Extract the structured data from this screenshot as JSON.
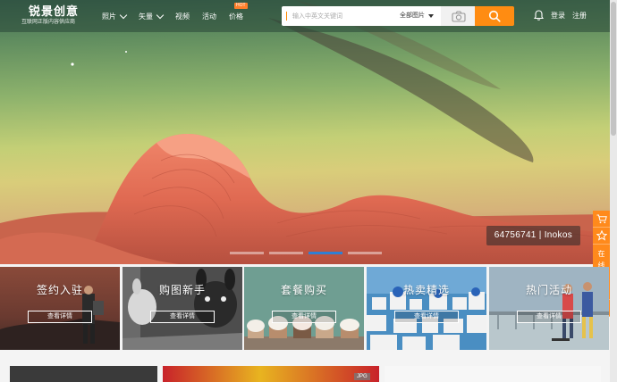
{
  "header": {
    "logo_title": "锐景创意",
    "logo_subtitle": "互联网正版内容供应商",
    "nav": [
      {
        "label": "照片",
        "dropdown": true
      },
      {
        "label": "矢量",
        "dropdown": true
      },
      {
        "label": "视频",
        "dropdown": false
      },
      {
        "label": "活动",
        "dropdown": false
      },
      {
        "label": "价格",
        "dropdown": false,
        "badge": "HOT"
      }
    ],
    "search": {
      "placeholder": "输入中英文关键词",
      "value": "",
      "scope": "全部图片",
      "camera_icon": "camera-icon",
      "search_icon": "search-icon"
    },
    "user": {
      "bell_icon": "bell-icon",
      "login": "登录",
      "register": "注册"
    }
  },
  "hero": {
    "photo_id": "64756741 | Inokos",
    "carousel_total": 4,
    "carousel_active": 2
  },
  "side_toolbar": {
    "cart_icon": "cart-icon",
    "star_icon": "star-icon",
    "customer_service": [
      "在",
      "线",
      "客",
      "服"
    ],
    "edit_icon": "edit-icon"
  },
  "cards": [
    {
      "title": "签约入驻",
      "button": "查看详情"
    },
    {
      "title": "购图新手",
      "button": "查看详情"
    },
    {
      "title": "套餐购买",
      "button": "查看详情"
    },
    {
      "title": "热卖精选",
      "button": "查看详情"
    },
    {
      "title": "热门活动",
      "button": "查看详情"
    }
  ],
  "bottom": {
    "badge": "JPG"
  },
  "colors": {
    "accent": "#ff8c12",
    "carousel_active": "#2f7fd3"
  }
}
